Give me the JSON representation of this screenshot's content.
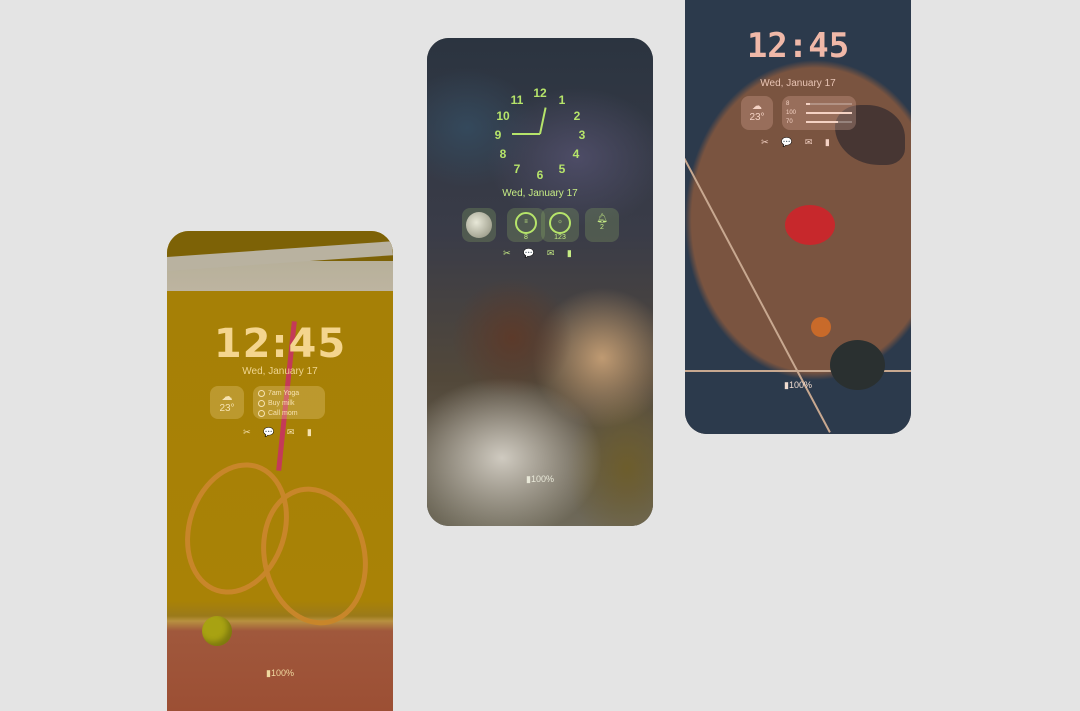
{
  "page": {
    "background": "#e4e4e4"
  },
  "phones": {
    "tennis": {
      "time": "12:45",
      "date": "Wed, January 17",
      "weather": {
        "icon": "cloud-icon",
        "temp": "23°"
      },
      "reminders": [
        "7am Yoga",
        "Buy milk",
        "Call mom"
      ],
      "notifications": "✂ 💬 ✉ ▮",
      "battery": "▮100%",
      "accent": "#f4d58e"
    },
    "couple": {
      "date": "Wed, January 17",
      "dial_numbers": [
        "12",
        "1",
        "2",
        "3",
        "4",
        "5",
        "6",
        "7",
        "8",
        "9",
        "10",
        "11"
      ],
      "steps_value": "8",
      "heart_value": "123",
      "alarm_value": "2",
      "notifications": "✂ 💬 ✉ ▮",
      "battery": "▮100%",
      "accent": "#b6e46a"
    },
    "court": {
      "time": "12:45",
      "date": "Wed, January 17",
      "weather": {
        "icon": "cloud-icon",
        "temp": "23°"
      },
      "stats": [
        {
          "label": "8",
          "fraction": 0.08
        },
        {
          "label": "100",
          "fraction": 1.0
        },
        {
          "label": "70",
          "fraction": 0.7
        }
      ],
      "notifications": "✂ 💬 ✉ ▮",
      "battery": "▮100%",
      "accent": "#f0b8a8"
    }
  }
}
